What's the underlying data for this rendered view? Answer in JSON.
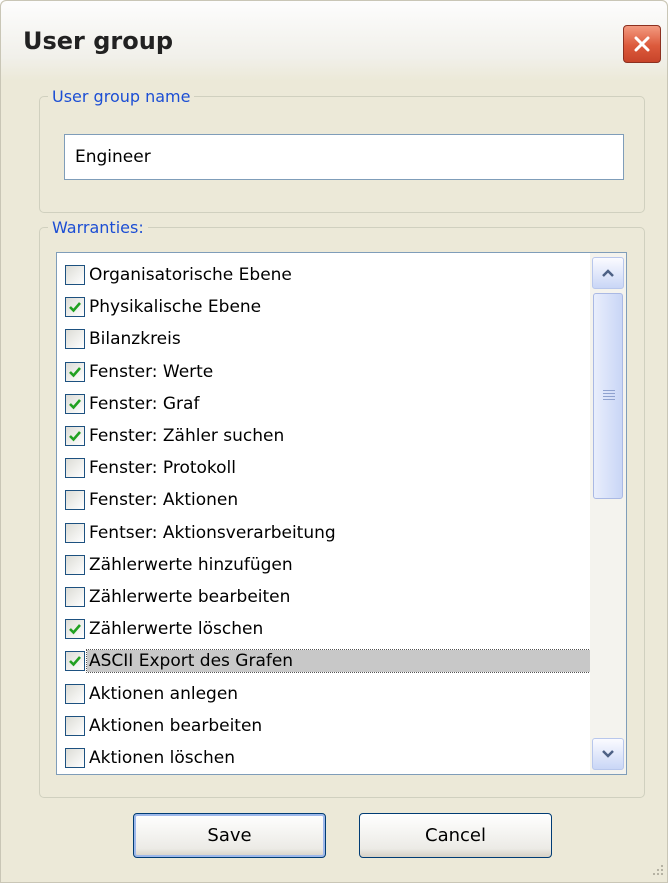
{
  "dialog": {
    "title": "User group"
  },
  "name_group": {
    "legend": "User group name",
    "value": "Engineer"
  },
  "warranties": {
    "legend": "Warranties:",
    "items": [
      {
        "label": "Organisatorische Ebene",
        "checked": false,
        "selected": false
      },
      {
        "label": "Physikalische Ebene",
        "checked": true,
        "selected": false
      },
      {
        "label": "Bilanzkreis",
        "checked": false,
        "selected": false
      },
      {
        "label": "Fenster: Werte",
        "checked": true,
        "selected": false
      },
      {
        "label": "Fenster: Graf",
        "checked": true,
        "selected": false
      },
      {
        "label": "Fenster: Zähler suchen",
        "checked": true,
        "selected": false
      },
      {
        "label": "Fenster: Protokoll",
        "checked": false,
        "selected": false
      },
      {
        "label": "Fenster: Aktionen",
        "checked": false,
        "selected": false
      },
      {
        "label": "Fentser: Aktionsverarbeitung",
        "checked": false,
        "selected": false
      },
      {
        "label": "Zählerwerte hinzufügen",
        "checked": false,
        "selected": false
      },
      {
        "label": "Zählerwerte bearbeiten",
        "checked": false,
        "selected": false
      },
      {
        "label": "Zählerwerte löschen",
        "checked": true,
        "selected": false
      },
      {
        "label": "ASCII Export des Grafen",
        "checked": true,
        "selected": true
      },
      {
        "label": "Aktionen anlegen",
        "checked": false,
        "selected": false
      },
      {
        "label": "Aktionen bearbeiten",
        "checked": false,
        "selected": false
      },
      {
        "label": "Aktionen löschen",
        "checked": false,
        "selected": false
      }
    ]
  },
  "buttons": {
    "save": "Save",
    "cancel": "Cancel"
  },
  "colors": {
    "legend": "#1c4ed4",
    "check": "#21a121",
    "close": "#dc5a3c",
    "dialog_bg": "#ece9d8"
  }
}
